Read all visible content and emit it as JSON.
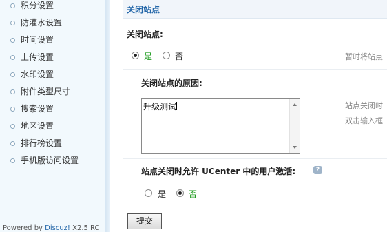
{
  "sidebar": {
    "items": [
      {
        "label": "积分设置"
      },
      {
        "label": "防灌水设置"
      },
      {
        "label": "时间设置"
      },
      {
        "label": "上传设置"
      },
      {
        "label": "水印设置"
      },
      {
        "label": "附件类型尺寸"
      },
      {
        "label": "搜索设置"
      },
      {
        "label": "地区设置"
      },
      {
        "label": "排行榜设置"
      },
      {
        "label": "手机版访问设置"
      }
    ],
    "powered_prefix": "Powered by ",
    "powered_brand": "Discuz!",
    "powered_version": " X2.5 RC"
  },
  "section": {
    "title": "关闭站点"
  },
  "close_site": {
    "label": "关闭站点:",
    "yes_label": "是",
    "no_label": "否",
    "selected": "yes",
    "hint": "暂时将站点"
  },
  "close_reason": {
    "label": "关闭站点的原因:",
    "value": "升级测试",
    "hint_line1": "站点关闭时",
    "hint_line2": "双击输入框"
  },
  "ucenter_activation": {
    "label": "站点关闭时允许 UCenter 中的用户激活:",
    "yes_label": "是",
    "no_label": "否",
    "selected": "no"
  },
  "submit": {
    "label": "提交"
  },
  "colors": {
    "accent": "#2366a8",
    "selected_option": "#1e9b1e",
    "sidebar_bg": "#f2f9fd"
  }
}
